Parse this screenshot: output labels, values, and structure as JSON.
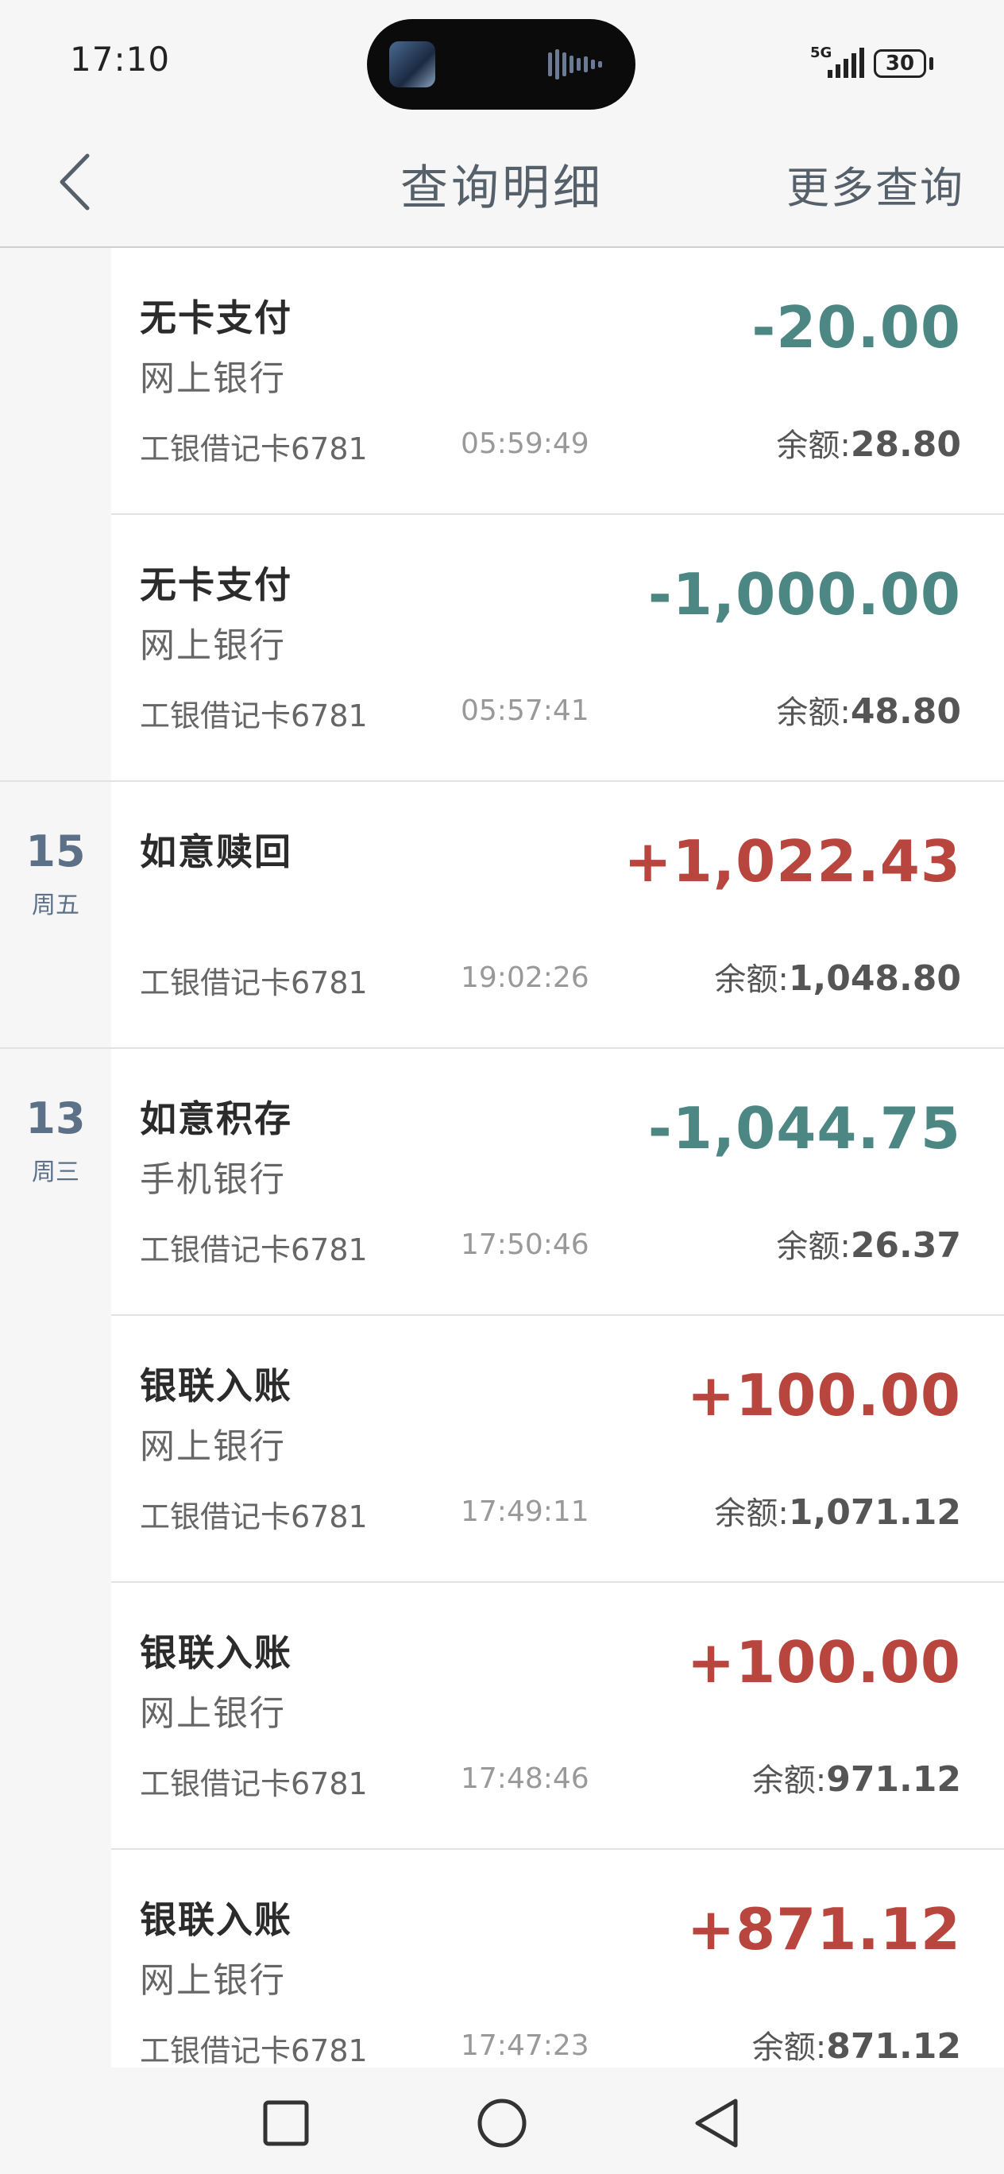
{
  "status_bar": {
    "time": "17:10",
    "network": "5G",
    "battery": "30"
  },
  "header": {
    "title": "查询明细",
    "more_label": "更多查询"
  },
  "balance_label": "余额:",
  "groups": [
    {
      "day": "",
      "weekday": "",
      "transactions": [
        {
          "title": "无卡支付",
          "channel": "网上银行",
          "card": "工银借记卡6781",
          "time": "05:59:49",
          "amount": "-20.00",
          "direction": "out",
          "balance": "28.80"
        },
        {
          "title": "无卡支付",
          "channel": "网上银行",
          "card": "工银借记卡6781",
          "time": "05:57:41",
          "amount": "-1,000.00",
          "direction": "out",
          "balance": "48.80"
        }
      ]
    },
    {
      "day": "15",
      "weekday": "周五",
      "transactions": [
        {
          "title": "如意赎回",
          "channel": "",
          "card": "工银借记卡6781",
          "time": "19:02:26",
          "amount": "+1,022.43",
          "direction": "in",
          "balance": "1,048.80"
        }
      ]
    },
    {
      "day": "13",
      "weekday": "周三",
      "transactions": [
        {
          "title": "如意积存",
          "channel": "手机银行",
          "card": "工银借记卡6781",
          "time": "17:50:46",
          "amount": "-1,044.75",
          "direction": "out",
          "balance": "26.37"
        },
        {
          "title": "银联入账",
          "channel": "网上银行",
          "card": "工银借记卡6781",
          "time": "17:49:11",
          "amount": "+100.00",
          "direction": "in",
          "balance": "1,071.12"
        },
        {
          "title": "银联入账",
          "channel": "网上银行",
          "card": "工银借记卡6781",
          "time": "17:48:46",
          "amount": "+100.00",
          "direction": "in",
          "balance": "971.12"
        },
        {
          "title": "银联入账",
          "channel": "网上银行",
          "card": "工银借记卡6781",
          "time": "17:47:23",
          "amount": "+871.12",
          "direction": "in",
          "balance": "871.12"
        }
      ]
    }
  ],
  "colors": {
    "outgoing": "#4d8784",
    "incoming": "#b8463e",
    "date": "#5c7187"
  },
  "icons": {
    "back": "chevron-left-icon",
    "nav_recents": "square-icon",
    "nav_home": "circle-icon",
    "nav_back": "triangle-back-icon"
  }
}
